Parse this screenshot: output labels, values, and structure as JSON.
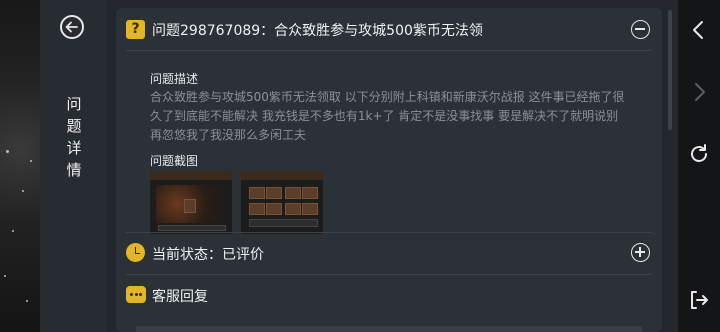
{
  "sidebar": {
    "title_chars": [
      "问",
      "题",
      "详",
      "情"
    ]
  },
  "issue": {
    "title": "问题298767089：合众致胜参与攻城500紫币无法领",
    "description_label": "问题描述",
    "description_text": "合众致胜参与攻城500紫币无法领取 以下分别附上科镇和新康沃尔战报 这件事已经拖了很久了到底能不能解决 我充钱是不多也有1k+了 肯定不是没事找事 要是解决不了就明说别再忽悠我了我没那么多闲工夫",
    "screenshot_label": "问题截图"
  },
  "status": {
    "label": "当前状态：已评价"
  },
  "reply": {
    "label": "客服回复"
  },
  "icons": {
    "back": "back-arrow-icon",
    "question": "question-mark-icon",
    "collapse": "minus-circle-icon",
    "expand": "plus-circle-icon",
    "clock": "clock-icon",
    "chat": "chat-bubble-icon",
    "nav_back": "chevron-left-icon",
    "nav_forward": "chevron-right-icon",
    "refresh": "refresh-icon",
    "exit": "exit-icon"
  },
  "colors": {
    "accent": "#e3b52b",
    "panel": "#2c3138",
    "muted_text": "#8a9099"
  }
}
